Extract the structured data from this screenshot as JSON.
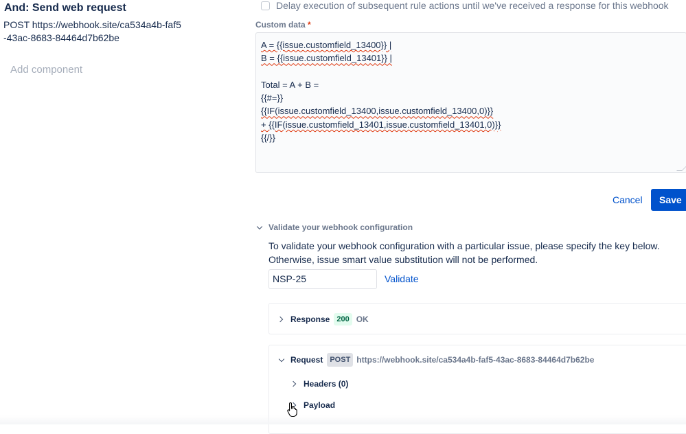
{
  "left": {
    "title": "And: Send web request",
    "description": "POST https://webhook.site/ca534a4b-faf5-43ac-8683-84464d7b62be",
    "add_component": "Add component"
  },
  "delay": {
    "label": "Delay execution of subsequent rule actions until we've received a response for this webhook",
    "checked": false
  },
  "custom_data": {
    "label": "Custom data",
    "required_marker": "*",
    "lines": [
      "A = {{issue.customfield_13400}} |",
      "B = {{issue.customfield_13401}} |",
      "",
      "Total = A + B =",
      "{{#=}}",
      "{{IF(issue.customfield_13400,issue.customfield_13400,0)}}",
      "+ {{IF(issue.customfield_13401,issue.customfield_13401,0)}}",
      "{{/}}"
    ]
  },
  "buttons": {
    "cancel": "Cancel",
    "save": "Save"
  },
  "validate": {
    "header": "Validate your webhook configuration",
    "description_line1": "To validate your webhook configuration with a particular issue, please specify the key below.",
    "description_line2": "Otherwise, issue smart value substitution will not be performed.",
    "issue_key": "NSP-25",
    "validate_link": "Validate"
  },
  "response": {
    "label": "Response",
    "status_code": "200",
    "status_text": "OK"
  },
  "request": {
    "label": "Request",
    "method": "POST",
    "url": "https://webhook.site/ca534a4b-faf5-43ac-8683-84464d7b62be",
    "headers_label": "Headers (0)",
    "payload_label": "Payload"
  },
  "colors": {
    "primary": "#0052cc",
    "success_bg": "#e3fcef",
    "success_text": "#006644",
    "required": "#de350b"
  }
}
